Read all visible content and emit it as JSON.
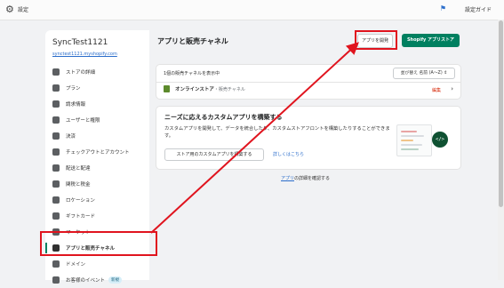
{
  "topbar": {
    "title": "設定",
    "guide": "設定ガイド"
  },
  "sidebar": {
    "store_name": "SyncTest1121",
    "store_url": "synctest1121.myshopify.com",
    "items": [
      {
        "label": "ストアの詳細",
        "icon": "store-icon"
      },
      {
        "label": "プラン",
        "icon": "plan-icon"
      },
      {
        "label": "請求情報",
        "icon": "billing-icon"
      },
      {
        "label": "ユーザーと権限",
        "icon": "user-icon"
      },
      {
        "label": "決済",
        "icon": "payment-icon"
      },
      {
        "label": "チェックアウトとアカウント",
        "icon": "checkout-icon"
      },
      {
        "label": "配送と配達",
        "icon": "shipping-icon"
      },
      {
        "label": "関税と税金",
        "icon": "tax-icon"
      },
      {
        "label": "ロケーション",
        "icon": "location-icon"
      },
      {
        "label": "ギフトカード",
        "icon": "gift-card-icon"
      },
      {
        "label": "マーケット",
        "icon": "market-icon"
      },
      {
        "label": "アプリと販売チャネル",
        "icon": "apps-icon",
        "active": true
      },
      {
        "label": "ドメイン",
        "icon": "domain-icon"
      },
      {
        "label": "お客様のイベント",
        "icon": "event-icon",
        "badge": "新規"
      }
    ]
  },
  "main": {
    "title": "アプリと販売チャネル",
    "develop_button": "アプリを開発",
    "store_button": "Shopify アプリストア",
    "channels": {
      "count_text": "1個の販売チャネルを表示中",
      "sort_label": "並び替え 名前 (A〜Z) ⇕",
      "online_store": "オンラインストア",
      "online_store_sub": " ・販売チャネル",
      "edit_label": "編集"
    },
    "custom": {
      "heading": "ニーズに応えるカスタムアプリを構築する",
      "body": "カスタムアプリを開発して、データを統合したり、カスタムストアフロントを構築したりすることができます。",
      "button": "ストア用のカスタムアプリを構築する",
      "link": "詳しくはこちら",
      "code_glyph": "</>"
    },
    "footer_link": "アプリ",
    "footer_text": "の詳細を確認する"
  },
  "colors": {
    "accent": "#008060",
    "highlight": "#e0141e",
    "link": "#2c6ecb"
  }
}
